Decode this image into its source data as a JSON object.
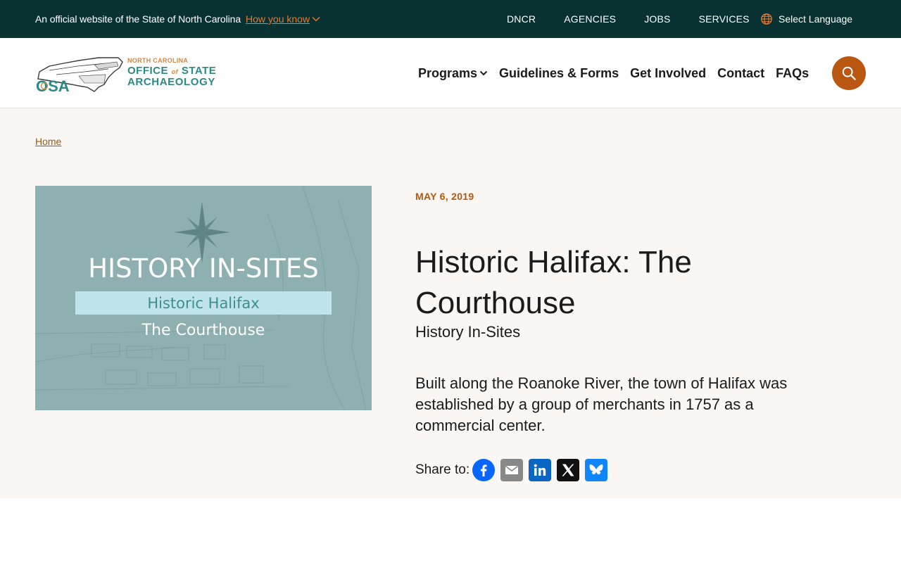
{
  "topbar": {
    "official_text": "An official website of the State of North Carolina",
    "how_you_know": "How you know",
    "links": [
      "DNCR",
      "AGENCIES",
      "JOBS",
      "SERVICES"
    ],
    "language": "Select Language"
  },
  "logo": {
    "line1": "NORTH CAROLINA",
    "line2_a": "OFFICE",
    "line2_of": "of",
    "line2_b": "STATE",
    "line3": "ARCHAEOLOGY",
    "badge": "OSA"
  },
  "nav": {
    "items": [
      "Programs",
      "Guidelines & Forms",
      "Get Involved",
      "Contact",
      "FAQs"
    ]
  },
  "breadcrumb": {
    "home": "Home"
  },
  "hero_image": {
    "title": "HISTORY IN-SITES",
    "subtitle": "Historic Halifax",
    "caption": "The Courthouse"
  },
  "article": {
    "date": "MAY 6, 2019",
    "title": "Historic Halifax: The Courthouse",
    "subtitle": "History In-Sites",
    "lede": "Built along the Roanoke River, the town of Halifax was established by a group of merchants in 1757 as a commercial center."
  },
  "share": {
    "label": "Share to:",
    "services": [
      "facebook-icon",
      "email-icon",
      "linkedin-icon",
      "x-icon",
      "bluesky-icon"
    ]
  },
  "colors": {
    "topbar": "#083232",
    "accent": "#b85612",
    "link_orange": "#e8772e",
    "band": "#f9f6f3"
  }
}
